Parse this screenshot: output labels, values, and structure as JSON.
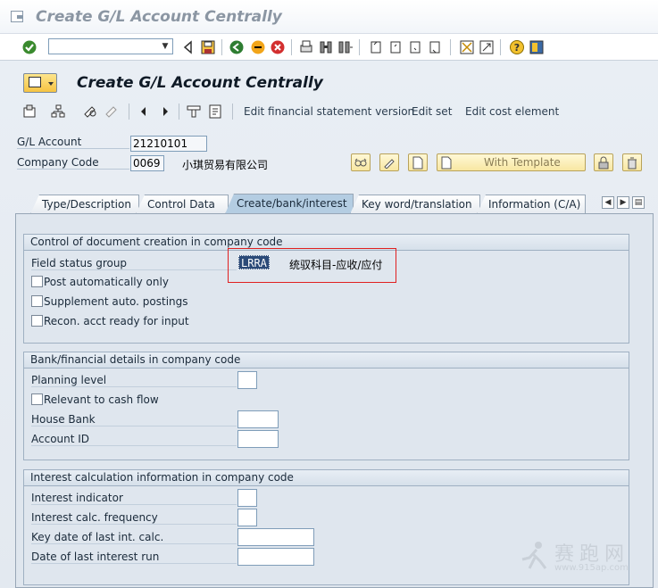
{
  "window": {
    "title": "Create G/L Account Centrally"
  },
  "system_toolbar": {
    "icons": [
      "enter-icon",
      "command-field",
      "back-icon",
      "save-icon",
      "back-nav-icon",
      "exit-icon",
      "cancel-icon",
      "print-icon",
      "find-icon",
      "find-next-icon",
      "first-page-icon",
      "previous-page-icon",
      "next-page-icon",
      "last-page-icon",
      "new-session-icon",
      "shortcut-icon",
      "help-icon",
      "layout-menu-icon"
    ],
    "command_value": ""
  },
  "app": {
    "title": "Create G/L Account Centrally",
    "toolbar_links": [
      "Edit financial statement version",
      "Edit set",
      "Edit cost element"
    ]
  },
  "header": {
    "gl_account_label": "G/L Account",
    "gl_account_value": "21210101",
    "company_code_label": "Company Code",
    "company_code_value": "0069",
    "company_name": "小琪贸易有限公司",
    "with_template_label": "With Template"
  },
  "tabs": [
    {
      "label": "Type/Description",
      "active": false
    },
    {
      "label": "Control Data",
      "active": false
    },
    {
      "label": "Create/bank/interest",
      "active": true
    },
    {
      "label": "Key word/translation",
      "active": false
    },
    {
      "label": "Information (C/A)",
      "active": false
    }
  ],
  "groups": {
    "doc_creation": {
      "title": "Control of document creation in company code",
      "field_status_group_label": "Field status group",
      "field_status_group_value": "LRRA",
      "field_status_group_desc": "统驭科目-应收/应付",
      "post_auto_label": "Post automatically only",
      "supplement_label": "Supplement auto. postings",
      "recon_label": "Recon. acct ready for input"
    },
    "bank": {
      "title": "Bank/financial details in company code",
      "planning_level_label": "Planning level",
      "cash_flow_label": "Relevant to cash flow",
      "house_bank_label": "House Bank",
      "account_id_label": "Account ID"
    },
    "interest": {
      "title": "Interest calculation information in company code",
      "indicator_label": "Interest indicator",
      "frequency_label": "Interest calc. frequency",
      "key_date_label": "Key date of last int. calc.",
      "last_run_label": "Date of last interest run"
    }
  },
  "checkboxes": {
    "post_auto": false,
    "supplement": false,
    "recon": false,
    "cash_flow": false
  },
  "watermark": {
    "text": "赛跑网",
    "url": "www.915ap.com"
  }
}
